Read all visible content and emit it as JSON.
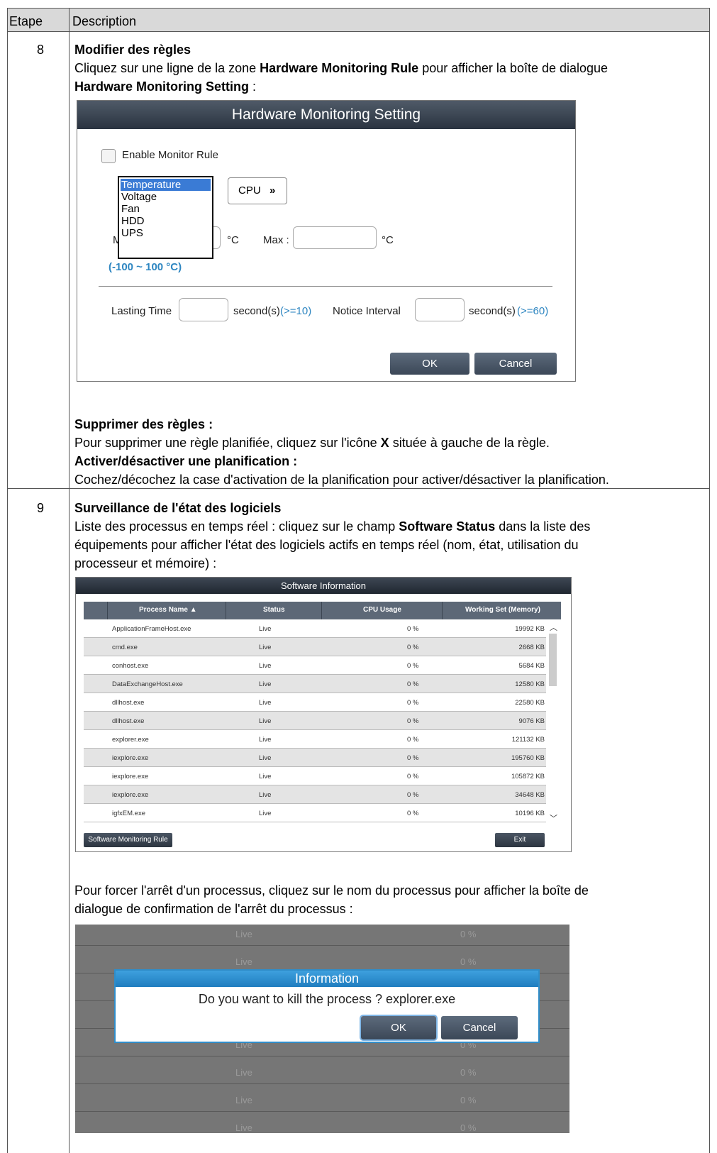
{
  "table": {
    "col1_header": "Etape",
    "col2_header": "Description"
  },
  "step8": {
    "number": "8",
    "heading": "Modifier des règles",
    "intro_1": "Cliquez sur une ligne de la zone ",
    "intro_bold_1": "Hardware Monitoring Rule",
    "intro_2": " pour afficher la boîte de dialogue",
    "intro_bold_2": "Hardware Monitoring Setting",
    "intro_3": " :",
    "delete_heading": "Supprimer des règles :",
    "delete_text_1": "Pour supprimer une règle planifiée, cliquez sur l'icône ",
    "delete_text_bold": "X",
    "delete_text_2": " située à gauche de la règle.",
    "toggle_heading": "Activer/désactiver une planification :",
    "toggle_text": "Cochez/décochez la case d'activation de la planification pour activer/désactiver la planification."
  },
  "hw_dialog": {
    "title": "Hardware Monitoring Setting",
    "enable_label": "Enable Monitor Rule",
    "enable_checked": false,
    "type_options": [
      "Temperature",
      "Voltage",
      "Fan",
      "HDD",
      "UPS"
    ],
    "type_selected": "Temperature",
    "component_value": "CPU",
    "min_prefix": "M",
    "min_unit": "°C",
    "max_label": "Max :",
    "max_unit": "°C",
    "range_hint": "(-100 ~ 100 °C)",
    "lasting_label": "Lasting Time",
    "lasting_unit": "second(s)",
    "lasting_hint": "(>=10)",
    "notice_label": "Notice Interval",
    "notice_unit": "second(s)",
    "notice_hint": "(>=60)",
    "ok_label": "OK",
    "cancel_label": "Cancel"
  },
  "step9": {
    "number": "9",
    "heading": "Surveillance de l'état des logiciels",
    "text_1": "Liste des processus en temps réel : cliquez sur le champ ",
    "text_bold": "Software Status",
    "text_2": " dans la liste des",
    "text_line2": "équipements pour afficher l'état des logiciels actifs en temps réel (nom, état, utilisation du",
    "text_line3": "processeur et mémoire) :",
    "kill_line1": "Pour forcer l'arrêt d'un processus, cliquez sur le nom du processus pour afficher la boîte de",
    "kill_line2": "dialogue de confirmation de l'arrêt du processus :"
  },
  "sw_dialog": {
    "title": "Software Information",
    "columns": [
      "Process Name ▲",
      "Status",
      "CPU Usage",
      "Working Set (Memory)"
    ],
    "rows": [
      {
        "name": "ApplicationFrameHost.exe",
        "status": "Live",
        "cpu": "0 %",
        "mem": "19992 KB"
      },
      {
        "name": "cmd.exe",
        "status": "Live",
        "cpu": "0 %",
        "mem": "2668 KB"
      },
      {
        "name": "conhost.exe",
        "status": "Live",
        "cpu": "0 %",
        "mem": "5684 KB"
      },
      {
        "name": "DataExchangeHost.exe",
        "status": "Live",
        "cpu": "0 %",
        "mem": "12580 KB"
      },
      {
        "name": "dllhost.exe",
        "status": "Live",
        "cpu": "0 %",
        "mem": "22580 KB"
      },
      {
        "name": "dllhost.exe",
        "status": "Live",
        "cpu": "0 %",
        "mem": "9076 KB"
      },
      {
        "name": "explorer.exe",
        "status": "Live",
        "cpu": "0 %",
        "mem": "121132 KB"
      },
      {
        "name": "iexplore.exe",
        "status": "Live",
        "cpu": "0 %",
        "mem": "195760 KB"
      },
      {
        "name": "iexplore.exe",
        "status": "Live",
        "cpu": "0 %",
        "mem": "105872 KB"
      },
      {
        "name": "iexplore.exe",
        "status": "Live",
        "cpu": "0 %",
        "mem": "34648 KB"
      },
      {
        "name": "igfxEM.exe",
        "status": "Live",
        "cpu": "0 %",
        "mem": "10196 KB"
      }
    ],
    "rule_button": "Software Monitoring Rule",
    "exit_button": "Exit"
  },
  "kill_dialog": {
    "bg_status": "Live",
    "bg_cpu": "0 %",
    "title": "Information",
    "message": "Do you want to kill the process ? explorer.exe",
    "ok_label": "OK",
    "cancel_label": "Cancel"
  }
}
